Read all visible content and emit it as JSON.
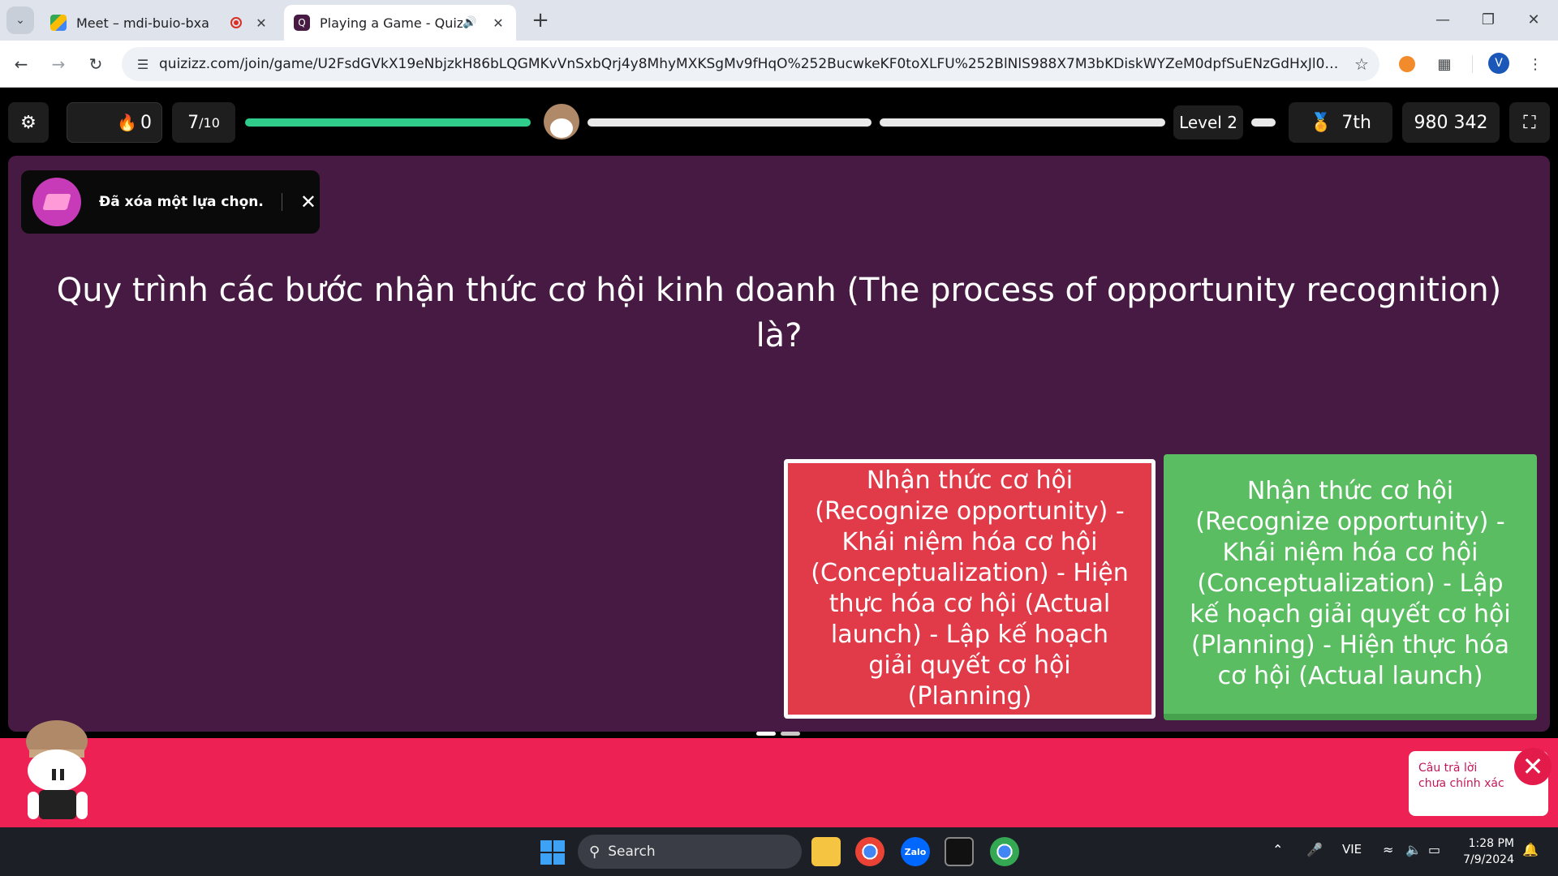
{
  "browser": {
    "tabs": [
      {
        "title": "Meet – mdi-buio-bxa",
        "active": false,
        "recording": true
      },
      {
        "title": "Playing a Game - Quizizz",
        "active": true,
        "audio": true
      }
    ],
    "url": "quizizz.com/join/game/U2FsdGVkX19eNbjzkH86bLQGMKvVnSxbQrj4y8MhyMXKSgMv9fHqO%252BucwkeKF0toXLFU%252BlNlS988X7M3bKDiskWYZeM0dpfSuENzGdHxJl0%253D?gameTy...",
    "profile_initial": "V",
    "icons": {
      "back": "arrow-left-icon",
      "forward": "arrow-right-icon",
      "reload": "reload-icon",
      "site_info": "tune-icon",
      "bookmark": "star-icon",
      "extensions": "puzzle-icon"
    }
  },
  "quiz": {
    "streak": "0",
    "question_counter": "7",
    "question_total": "/10",
    "level": "Level 2",
    "rank": "7th",
    "score": "980 342",
    "toast": "Đã xóa một lựa chọn.",
    "question": "Quy trình các bước nhận thức cơ hội kinh doanh (The process of opportunity recognition) là?",
    "options": [
      {
        "text": "Nhận thức cơ hội (Recognize opportunity) - Khái niệm hóa cơ hội (Conceptualization) - Hiện thực hóa cơ hội (Actual launch) - Lập kế hoạch giải quyết cơ hội (Planning)",
        "state": "incorrect",
        "color": "#e13a48"
      },
      {
        "text": "Nhận thức cơ hội (Recognize opportunity) - Khái niệm hóa cơ hội (Conceptualization) - Lập kế hoạch giải quyết cơ hội (Planning) - Hiện thực hóa cơ hội (Actual launch)",
        "state": "correct",
        "color": "#5bbd62"
      }
    ],
    "feedback": "Câu trả lời chưa chính xác",
    "colors": {
      "stage": "#461a42",
      "feedback_bar": "#ee2154",
      "progress": "#2fcc8b"
    }
  },
  "taskbar": {
    "search_placeholder": "Search",
    "apps": [
      "file-explorer-icon",
      "chrome-icon",
      "zalo-icon",
      "terminal-icon",
      "chrome-profile-icon"
    ],
    "zalo_label": "Zalo",
    "language": "VIE",
    "time": "1:28 PM",
    "date": "7/9/2024"
  }
}
